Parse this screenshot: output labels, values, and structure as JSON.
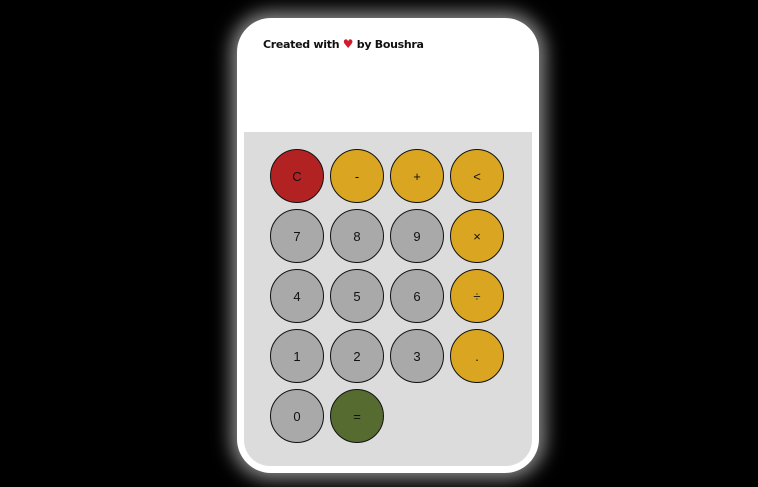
{
  "credit": {
    "prefix": "Created with",
    "heart": "♥",
    "suffix": "by Boushra"
  },
  "display": {
    "value": ""
  },
  "keys": {
    "clear": "C",
    "minus": "-",
    "plus": "+",
    "backspace": "<",
    "seven": "7",
    "eight": "8",
    "nine": "9",
    "multiply": "×",
    "four": "4",
    "five": "5",
    "six": "6",
    "divide": "÷",
    "one": "1",
    "two": "2",
    "three": "3",
    "decimal": ".",
    "zero": "0",
    "equals": "="
  },
  "colors": {
    "number_key": "#a9a9a9",
    "operator_key": "#daa520",
    "clear_key": "#b22222",
    "equals_key": "#556b2f",
    "keypad_background": "#dcdcdc",
    "heart": "#d11a2a"
  }
}
